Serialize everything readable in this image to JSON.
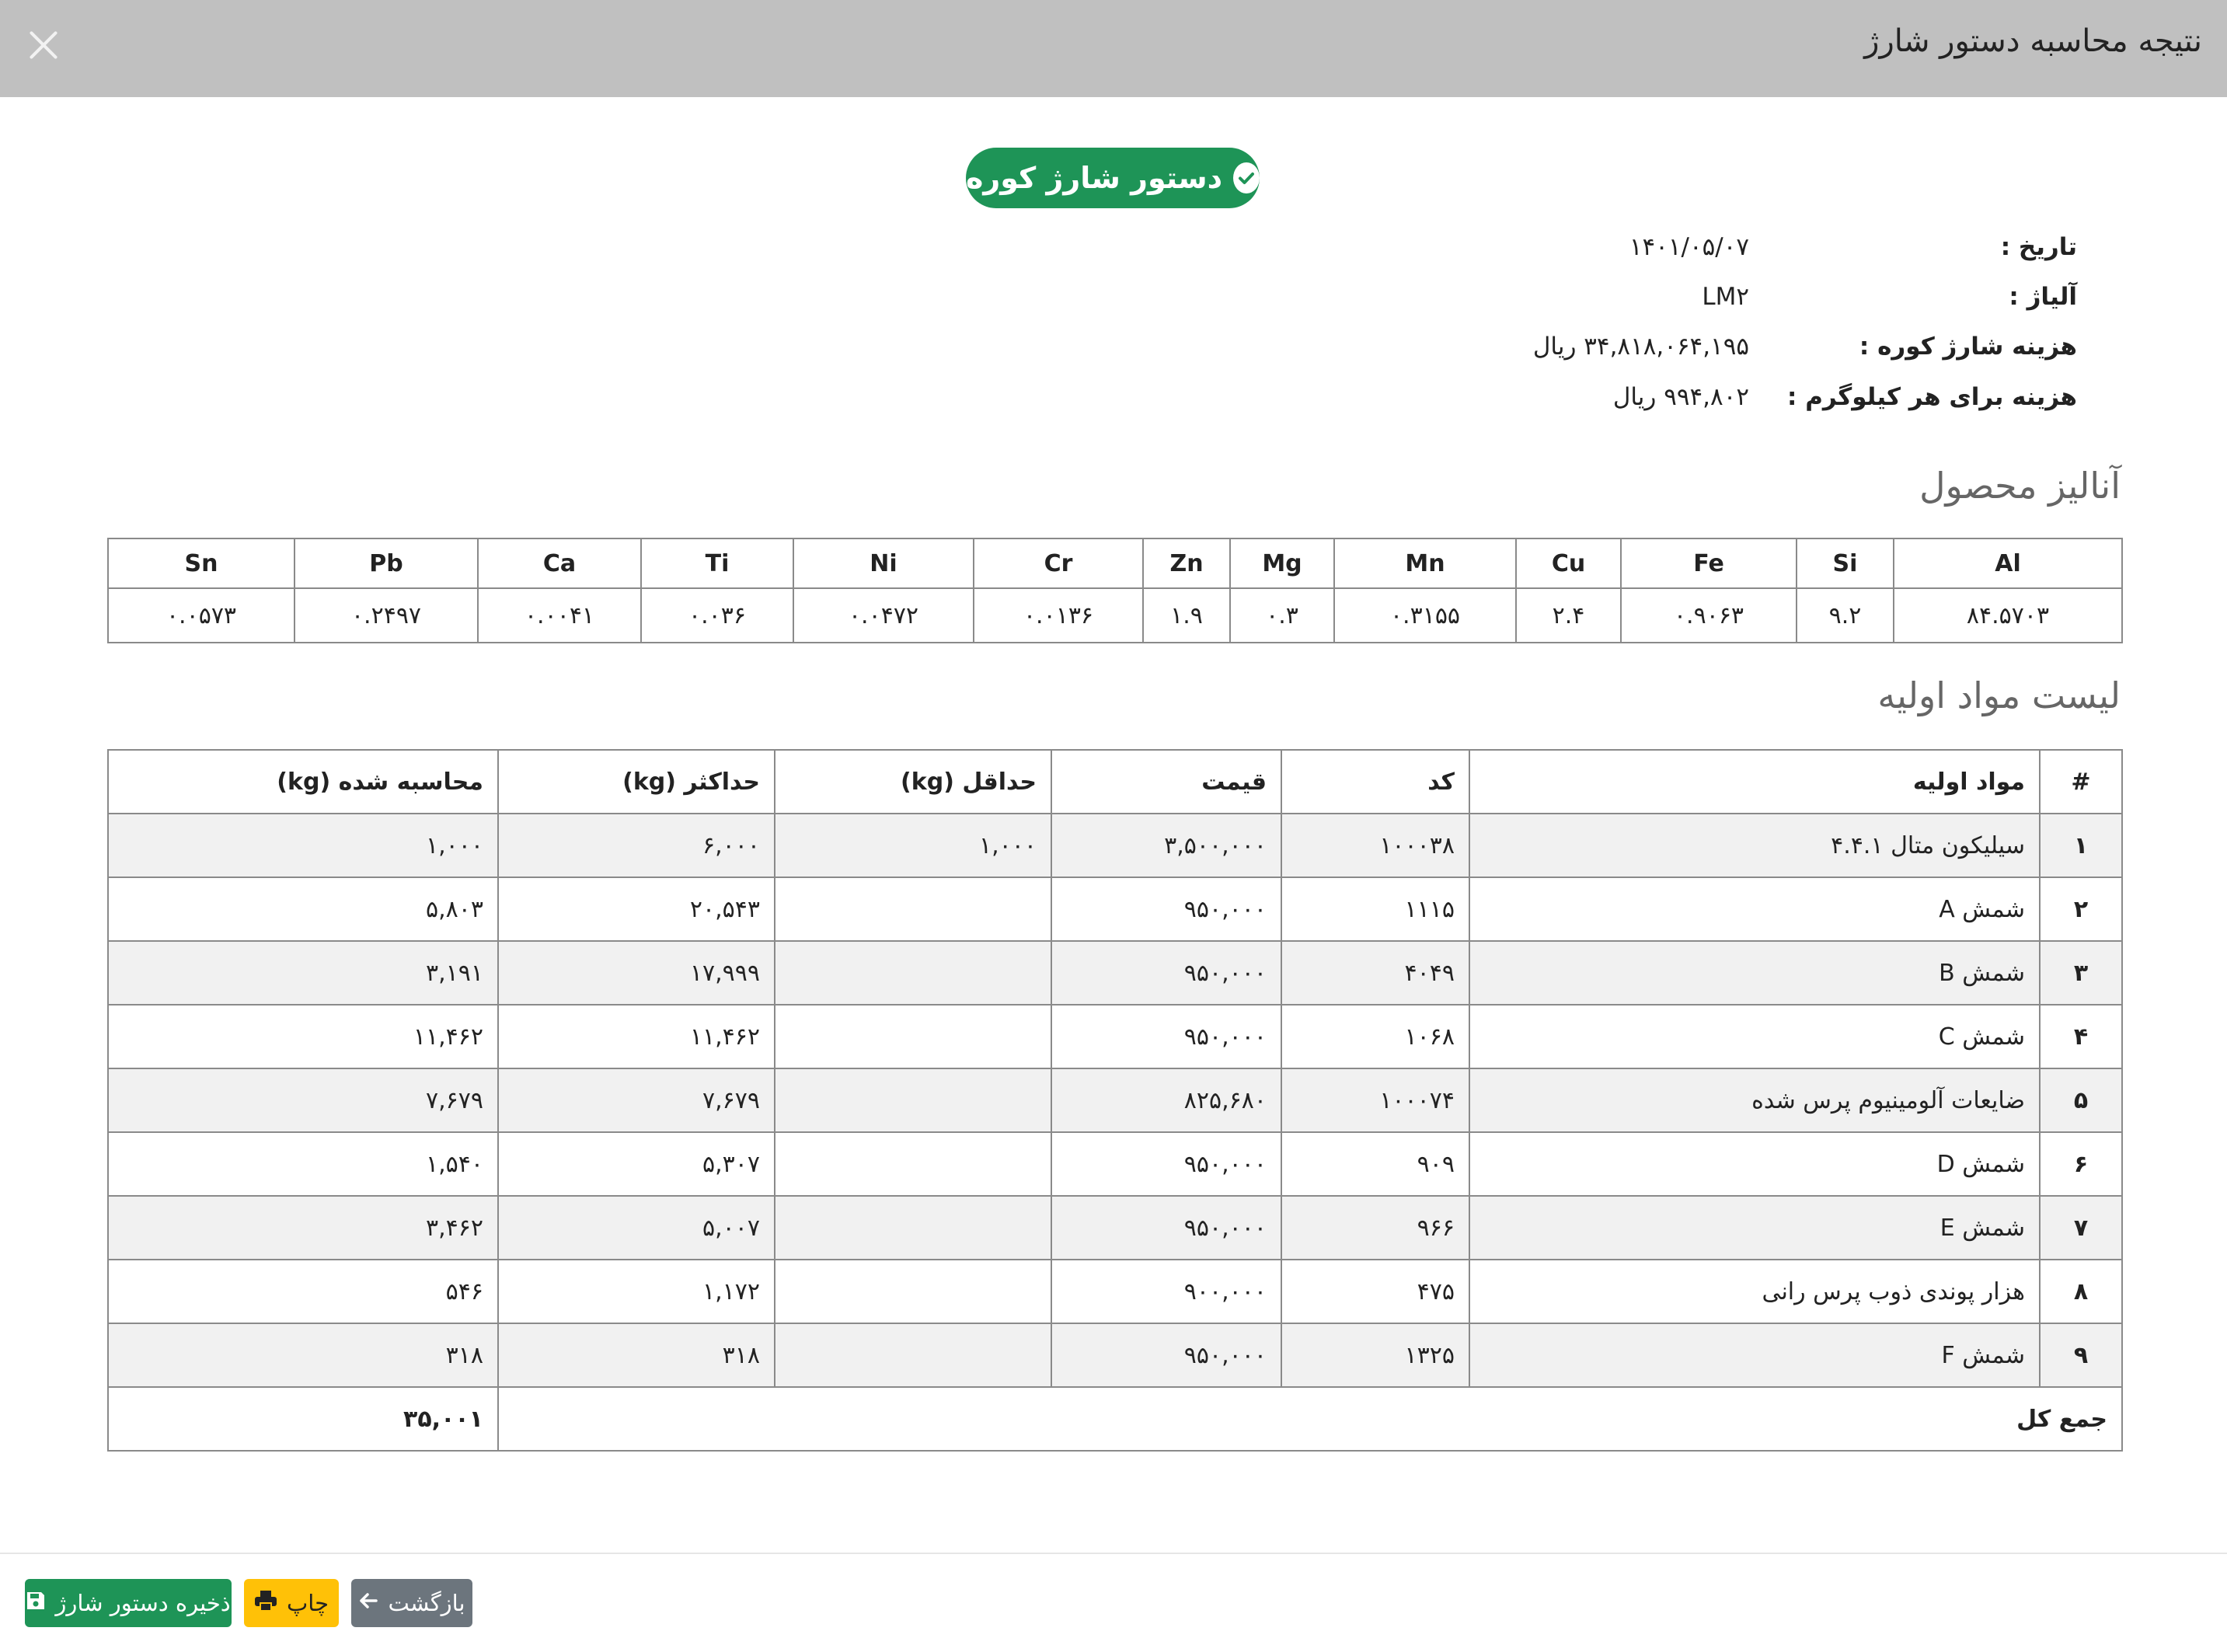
{
  "modal": {
    "title": "نتیجه محاسبه دستور شارژ",
    "close_icon": "close-icon"
  },
  "badge": {
    "label": "دستور شارژ کوره",
    "icon": "check-circle-icon",
    "color": "#1e9457"
  },
  "info": {
    "date_label": "تاریخ :",
    "date_value": "۱۴۰۱/۰۵/۰۷",
    "alloy_label": "آلیاژ :",
    "alloy_value": "LM۲",
    "cost_label": "هزینه شارژ کوره :",
    "cost_value": "۳۴,۸۱۸,۰۶۴,۱۹۵ ریال",
    "per_kg_label": "هزینه برای هر کیلوگرم :",
    "per_kg_value": "۹۹۴,۸۰۲ ریال"
  },
  "analysis": {
    "title": "آنالیز محصول",
    "headers": [
      "Al",
      "Si",
      "Fe",
      "Cu",
      "Mn",
      "Mg",
      "Zn",
      "Cr",
      "Ni",
      "Ti",
      "Ca",
      "Pb",
      "Sn"
    ],
    "values": [
      "۸۴.۵۷۰۳",
      "۹.۲",
      "۰.۹۰۶۳",
      "۲.۴",
      "۰.۳۱۵۵",
      "۰.۳",
      "۱.۹",
      "۰.۰۱۳۶",
      "۰.۰۴۷۲",
      "۰.۰۳۶",
      "۰.۰۰۴۱",
      "۰.۲۴۹۷",
      "۰.۰۵۷۳"
    ]
  },
  "materials": {
    "title": "لیست مواد اولیه",
    "headers": {
      "index": "#",
      "name": "مواد اولیه",
      "code": "کد",
      "price": "قیمت",
      "min": "حداقل (kg)",
      "max": "حداکثر (kg)",
      "calc": "محاسبه شده (kg)"
    },
    "rows": [
      {
        "index": "۱",
        "name": "سیلیکون متال ۴.۴.۱",
        "code": "۱۰۰۰۳۸",
        "price": "۳,۵۰۰,۰۰۰",
        "min": "۱,۰۰۰",
        "max": "۶,۰۰۰",
        "calc": "۱,۰۰۰"
      },
      {
        "index": "۲",
        "name": "شمش A",
        "code": "۱۱۱۵",
        "price": "۹۵۰,۰۰۰",
        "min": "",
        "max": "۲۰,۵۴۳",
        "calc": "۵,۸۰۳"
      },
      {
        "index": "۳",
        "name": "شمش B",
        "code": "۴۰۴۹",
        "price": "۹۵۰,۰۰۰",
        "min": "",
        "max": "۱۷,۹۹۹",
        "calc": "۳,۱۹۱"
      },
      {
        "index": "۴",
        "name": "شمش C",
        "code": "۱۰۶۸",
        "price": "۹۵۰,۰۰۰",
        "min": "",
        "max": "۱۱,۴۶۲",
        "calc": "۱۱,۴۶۲"
      },
      {
        "index": "۵",
        "name": "ضایعات آلومینیوم پرس شده",
        "code": "۱۰۰۰۷۴",
        "price": "۸۲۵,۶۸۰",
        "min": "",
        "max": "۷,۶۷۹",
        "calc": "۷,۶۷۹"
      },
      {
        "index": "۶",
        "name": "شمش D",
        "code": "۹۰۹",
        "price": "۹۵۰,۰۰۰",
        "min": "",
        "max": "۵,۳۰۷",
        "calc": "۱,۵۴۰"
      },
      {
        "index": "۷",
        "name": "شمش E",
        "code": "۹۶۶",
        "price": "۹۵۰,۰۰۰",
        "min": "",
        "max": "۵,۰۰۷",
        "calc": "۳,۴۶۲"
      },
      {
        "index": "۸",
        "name": "هزار پوندی ذوب پرس رانی",
        "code": "۴۷۵",
        "price": "۹۰۰,۰۰۰",
        "min": "",
        "max": "۱,۱۷۲",
        "calc": "۵۴۶"
      },
      {
        "index": "۹",
        "name": "شمش F",
        "code": "۱۳۲۵",
        "price": "۹۵۰,۰۰۰",
        "min": "",
        "max": "۳۱۸",
        "calc": "۳۱۸"
      }
    ],
    "total_label": "جمع کل",
    "total_value": "۳۵,۰۰۱"
  },
  "footer": {
    "back_label": "بازگشت",
    "back_icon": "arrow-left-icon",
    "print_label": "چاپ",
    "print_icon": "printer-icon",
    "save_label": "ذخیره دستور شارژ",
    "save_icon": "floppy-disk-icon",
    "colors": {
      "back": "#6c757d",
      "print": "#ffc107",
      "save": "#1e9457"
    }
  }
}
